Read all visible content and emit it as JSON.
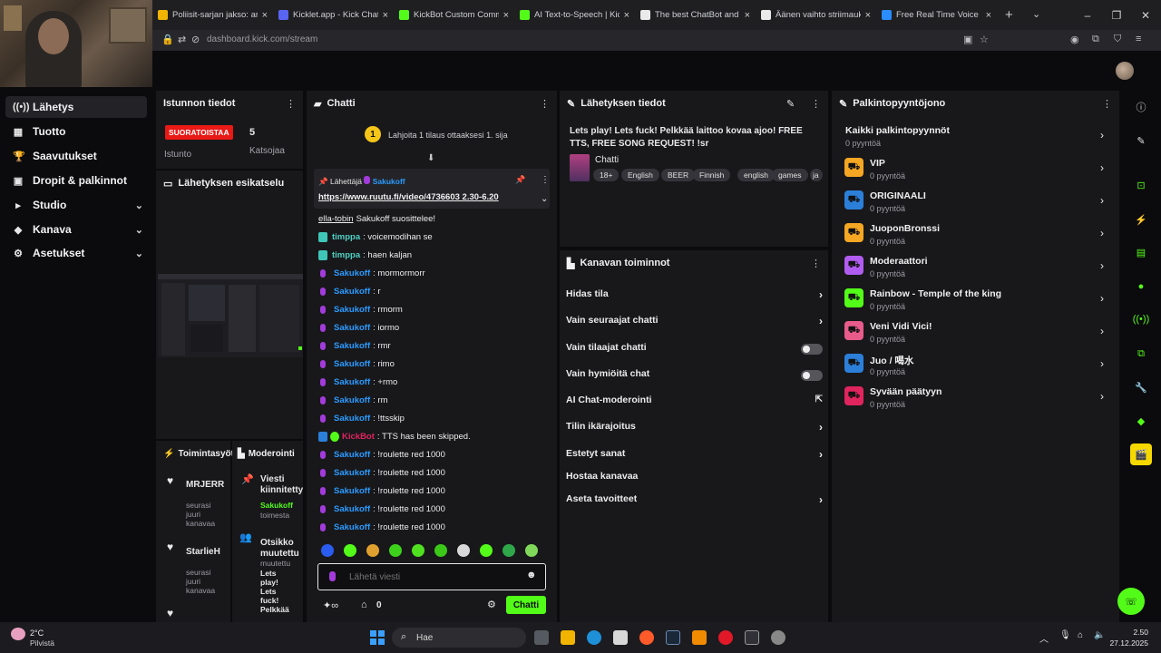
{
  "browser": {
    "tabs": [
      {
        "title": "Poliisit-sarjan jakso: arkea ja",
        "color": "#f1b400"
      },
      {
        "title": "Kicklet.app - Kick Chat",
        "color": "#5865f2"
      },
      {
        "title": "KickBot Custom Commands",
        "color": "#53fc18"
      },
      {
        "title": "AI Text-to-Speech | KickBot",
        "color": "#53fc18"
      },
      {
        "title": "The best ChatBot and Widg",
        "color": "#eaeaea"
      },
      {
        "title": "Äänen vaihto striimauksess",
        "color": "#eaeaea"
      },
      {
        "title": "Free Real Time Voice Chang",
        "color": "#2b8cff"
      }
    ],
    "url": "dashboard.kick.com/stream",
    "new_tab": "+",
    "tab_close": "×"
  },
  "nav": {
    "items": [
      {
        "label": "Lähetys",
        "icon": "((•))",
        "active": true
      },
      {
        "label": "Tuotto",
        "icon": "▦"
      },
      {
        "label": "Saavutukset",
        "icon": "🏆"
      },
      {
        "label": "Dropit & palkinnot",
        "icon": "▣"
      },
      {
        "label": "Studio",
        "icon": "▸",
        "chevron": "⌄"
      },
      {
        "label": "Kanava",
        "icon": "◆",
        "chevron": "⌄"
      },
      {
        "label": "Asetukset",
        "icon": "⚙",
        "chevron": "⌄"
      }
    ]
  },
  "session": {
    "title": "Istunnon tiedot",
    "live_badge": "SUORATOISTAA",
    "viewers": "5",
    "viewers_label": "Katsojaa",
    "session_label": "Istunto"
  },
  "preview": {
    "title": "Lähetyksen esikatselu"
  },
  "activity": {
    "title": "Toimintasyöte",
    "events": [
      {
        "name": "MRJERR",
        "text": "seurasi juuri kanavaa"
      },
      {
        "name": "StarlieH",
        "text": "seurasi juuri kanavaa"
      }
    ]
  },
  "moderation": {
    "title": "Moderointi",
    "item1_title": "Viesti kiinnitetty",
    "item1_user": "Sakukoff",
    "item1_sub": "toimesta",
    "item2_title": "Otsikko muutettu",
    "item2_sub": "muutettu",
    "item2_text": "Lets play! Lets fuck! Pelkkää laittoo"
  },
  "chat": {
    "title": "Chatti",
    "gift_banner": "Lahjoita 1 tilaus ottaaksesi 1. sija",
    "gift_rank": "1",
    "pinned_by_label": "Lähettäjä",
    "pinned_by": "Sakukoff",
    "pinned_text": "https://www.ruutu.fi/video/4736603 2.30-6.20",
    "messages": [
      {
        "user": "ella-tobin",
        "text": "Sakukoff suosittelee!",
        "color": "#ececec",
        "badge": "none",
        "underline": true
      },
      {
        "user": "timppa",
        "text": ": voicemodihan se",
        "color": "#4fd0c4",
        "badge": "teal"
      },
      {
        "user": "timppa",
        "text": ": haen kaljan",
        "color": "#4fd0c4",
        "badge": "teal"
      },
      {
        "user": "Sakukoff",
        "text": ": mormormorr",
        "color": "#2b9bff",
        "badge": "mic"
      },
      {
        "user": "Sakukoff",
        "text": ": r",
        "color": "#2b9bff",
        "badge": "mic"
      },
      {
        "user": "Sakukoff",
        "text": ": rmorm",
        "color": "#2b9bff",
        "badge": "mic"
      },
      {
        "user": "Sakukoff",
        "text": ": iormo",
        "color": "#2b9bff",
        "badge": "mic"
      },
      {
        "user": "Sakukoff",
        "text": ": rmr",
        "color": "#2b9bff",
        "badge": "mic"
      },
      {
        "user": "Sakukoff",
        "text": ": rimo",
        "color": "#2b9bff",
        "badge": "mic"
      },
      {
        "user": "Sakukoff",
        "text": ": +rmo",
        "color": "#2b9bff",
        "badge": "mic"
      },
      {
        "user": "Sakukoff",
        "text": ": rm",
        "color": "#2b9bff",
        "badge": "mic"
      },
      {
        "user": "Sakukoff",
        "text": ": !ttsskip",
        "color": "#2b9bff",
        "badge": "mic"
      },
      {
        "user": "KickBot",
        "text": ": TTS has been skipped.",
        "color": "#e0245e",
        "badge": "bot"
      },
      {
        "user": "Sakukoff",
        "text": ": !roulette red 1000",
        "color": "#2b9bff",
        "badge": "mic"
      },
      {
        "user": "Sakukoff",
        "text": ": !roulette red 1000",
        "color": "#2b9bff",
        "badge": "mic"
      },
      {
        "user": "Sakukoff",
        "text": ": !roulette red 1000",
        "color": "#2b9bff",
        "badge": "mic"
      },
      {
        "user": "Sakukoff",
        "text": ": !roulette red 1000",
        "color": "#2b9bff",
        "badge": "mic"
      },
      {
        "user": "Sakukoff",
        "text": ": !roulette red 1000",
        "color": "#2b9bff",
        "badge": "mic"
      }
    ],
    "input_placeholder": "Lähetä viesti",
    "points": "0",
    "send_label": "Chatti"
  },
  "stream_info": {
    "title": "Lähetyksen tiedot",
    "stream_title": "Lets play! Lets fuck! Pelkkää laittoo kovaa ajoo! FREE TTS, FREE SONG REQUEST! !sr",
    "category": "Chatti",
    "tags": [
      "18+",
      "English",
      "BEER",
      "Finnish",
      "english",
      "games",
      "ja"
    ]
  },
  "channel_actions": {
    "title": "Kanavan toiminnot",
    "items": [
      {
        "label": "Hidas tila",
        "control": "arrow"
      },
      {
        "label": "Vain seuraajat chatti",
        "control": "arrow"
      },
      {
        "label": "Vain tilaajat chatti",
        "control": "toggle"
      },
      {
        "label": "Vain hymiöitä chat",
        "control": "toggle"
      },
      {
        "label": "AI Chat-moderointi",
        "control": "external"
      },
      {
        "label": "Tilin ikärajoitus",
        "control": "arrow"
      },
      {
        "label": "Estetyt sanat",
        "control": "arrow"
      },
      {
        "label": "Hostaa kanavaa",
        "control": "none"
      },
      {
        "label": "Aseta tavoitteet",
        "control": "arrow"
      }
    ]
  },
  "rewards": {
    "title": "Palkintopyyntöjono",
    "items": [
      {
        "name": "Kaikki palkintopyynnöt",
        "count": "0 pyyntöä",
        "color": ""
      },
      {
        "name": "VIP",
        "count": "0 pyyntöä",
        "color": "#f5a623"
      },
      {
        "name": "ORIGINAALI",
        "count": "0 pyyntöä",
        "color": "#2b7fd9"
      },
      {
        "name": "JuoponBronssi",
        "count": "0 pyyntöä",
        "color": "#f5a623"
      },
      {
        "name": "Moderaattori",
        "count": "0 pyyntöä",
        "color": "#b15cf0"
      },
      {
        "name": "Rainbow - Temple of the king",
        "count": "0 pyyntöä",
        "color": "#53fc18"
      },
      {
        "name": "Veni Vidi Vici!",
        "count": "0 pyyntöä",
        "color": "#e85b8a"
      },
      {
        "name": "Juo / 喝水",
        "count": "0 pyyntöä",
        "color": "#2b7fd9"
      },
      {
        "name": "Syvään päätyyn",
        "count": "0 pyyntöä",
        "color": "#e0245e"
      }
    ]
  },
  "taskbar": {
    "weather_temp": "2°C",
    "weather_desc": "Pilvistä",
    "search": "Hae",
    "time": "2.50",
    "date": "27.12.2025"
  },
  "colors": {
    "accent": "#53fc18",
    "live": "#e91916"
  }
}
